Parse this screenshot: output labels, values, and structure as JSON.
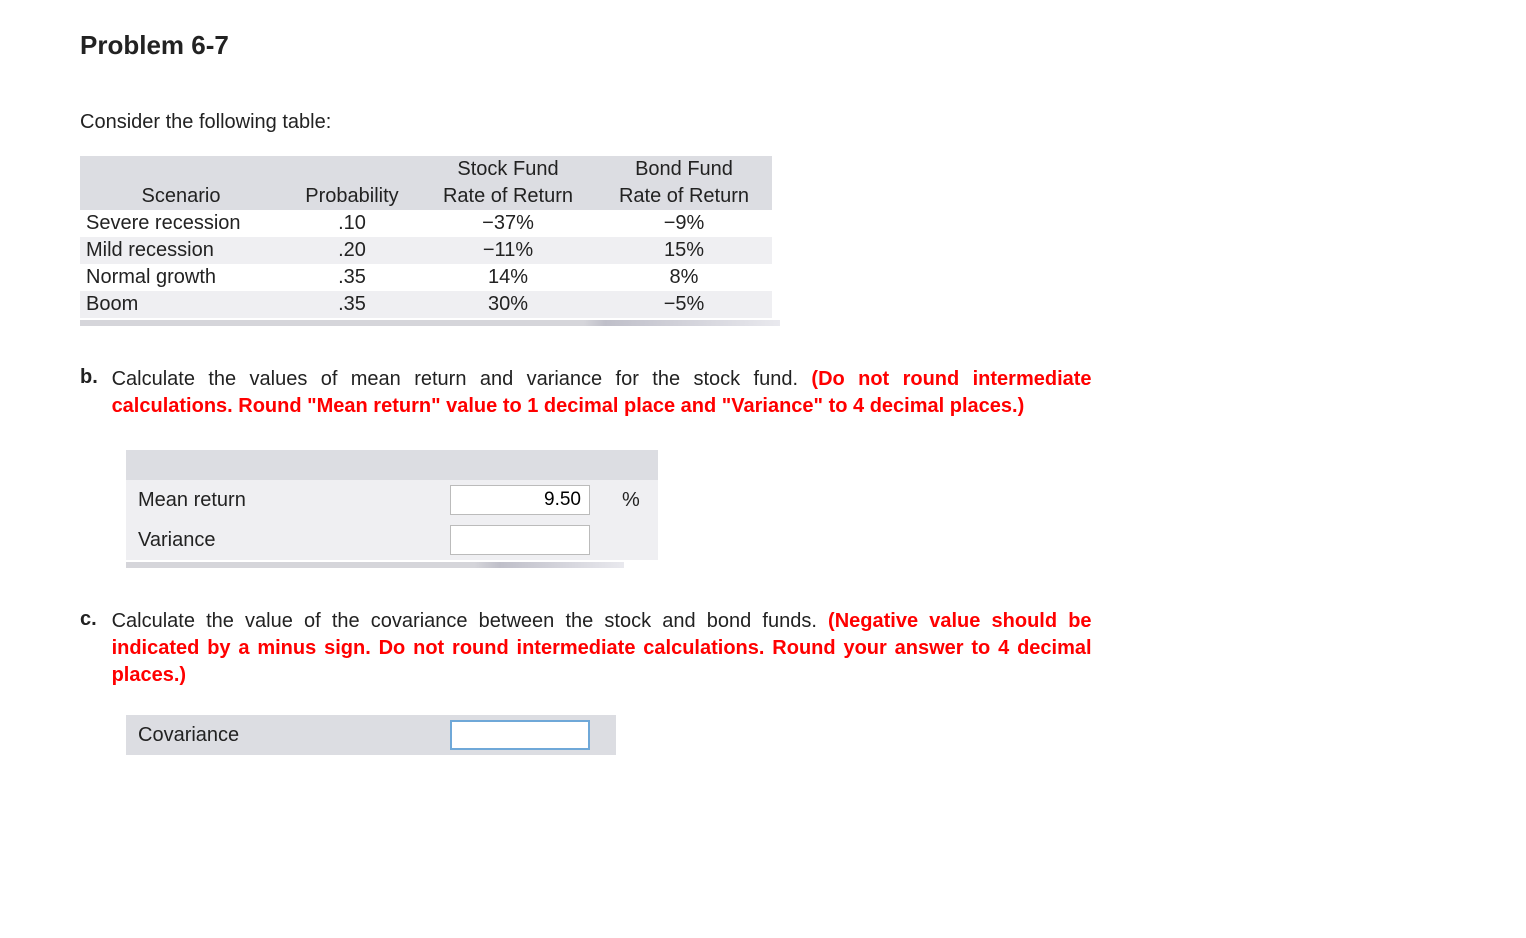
{
  "title": "Problem 6-7",
  "intro": "Consider the following table:",
  "table": {
    "headers": {
      "top_stock": "Stock Fund",
      "top_bond": "Bond Fund",
      "scenario": "Scenario",
      "probability": "Probability",
      "stock": "Rate of Return",
      "bond": "Rate of Return"
    },
    "rows": [
      {
        "scenario": "Severe recession",
        "prob": ".10",
        "stock": "−37%",
        "bond": "−9%"
      },
      {
        "scenario": "Mild recession",
        "prob": ".20",
        "stock": "−11%",
        "bond": "15%"
      },
      {
        "scenario": "Normal growth",
        "prob": ".35",
        "stock": "14%",
        "bond": "8%"
      },
      {
        "scenario": "Boom",
        "prob": ".35",
        "stock": "30%",
        "bond": "−5%"
      }
    ]
  },
  "partB": {
    "letter": "b.",
    "text": "Calculate the values of mean return and variance for the stock fund. ",
    "red": "(Do not round intermediate calculations. Round \"Mean return\" value to 1 decimal place and \"Variance\" to 4 decimal places.)",
    "rows": [
      {
        "label": "Mean return",
        "value": "9.50",
        "suffix": "%"
      },
      {
        "label": "Variance",
        "value": "",
        "suffix": ""
      }
    ]
  },
  "partC": {
    "letter": "c.",
    "text": "Calculate the value of the covariance between the stock and bond funds. ",
    "red": "(Negative value should be indicated by a minus sign. Do not round intermediate calculations. Round your answer to 4 decimal places.)",
    "row": {
      "label": "Covariance",
      "value": ""
    }
  }
}
